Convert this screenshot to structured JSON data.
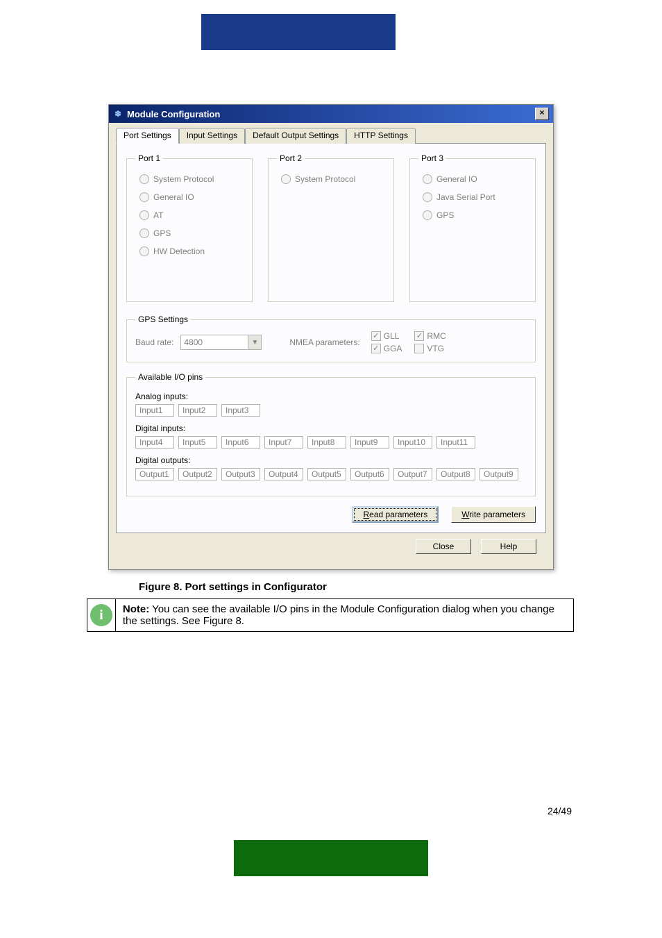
{
  "titlebar": {
    "title": "Module Configuration",
    "close": "×"
  },
  "tabs": {
    "port": "Port Settings",
    "input": "Input Settings",
    "output": "Default Output Settings",
    "http": "HTTP Settings"
  },
  "port1": {
    "legend": "Port 1",
    "opts": [
      "System Protocol",
      "General IO",
      "AT",
      "GPS",
      "HW Detection"
    ]
  },
  "port2": {
    "legend": "Port 2",
    "opts": [
      "System Protocol"
    ]
  },
  "port3": {
    "legend": "Port 3",
    "opts": [
      "General IO",
      "Java Serial Port",
      "GPS"
    ]
  },
  "gps": {
    "legend": "GPS Settings",
    "baud_label": "Baud rate:",
    "baud_value": "4800",
    "nmea_label": "NMEA parameters:",
    "gll": "GLL",
    "rmc": "RMC",
    "gga": "GGA",
    "vtg": "VTG"
  },
  "io": {
    "legend": "Available I/O pins",
    "analog_label": "Analog inputs:",
    "analog": [
      "Input1",
      "Input2",
      "Input3"
    ],
    "digital_in_label": "Digital inputs:",
    "digital_in": [
      "Input4",
      "Input5",
      "Input6",
      "Input7",
      "Input8",
      "Input9",
      "Input10",
      "Input11"
    ],
    "digital_out_label": "Digital outputs:",
    "digital_out": [
      "Output1",
      "Output2",
      "Output3",
      "Output4",
      "Output5",
      "Output6",
      "Output7",
      "Output8",
      "Output9"
    ]
  },
  "buttons": {
    "read": "Read parameters",
    "write": "Write parameters",
    "close": "Close",
    "help": "Help"
  },
  "caption": "Figure 8. Port settings in Configurator",
  "note": {
    "prefix": "Note:",
    "text": " You can see the available I/O pins in the Module Configuration dialog when you change the settings. See Figure 8."
  },
  "pagenum": "24/49"
}
